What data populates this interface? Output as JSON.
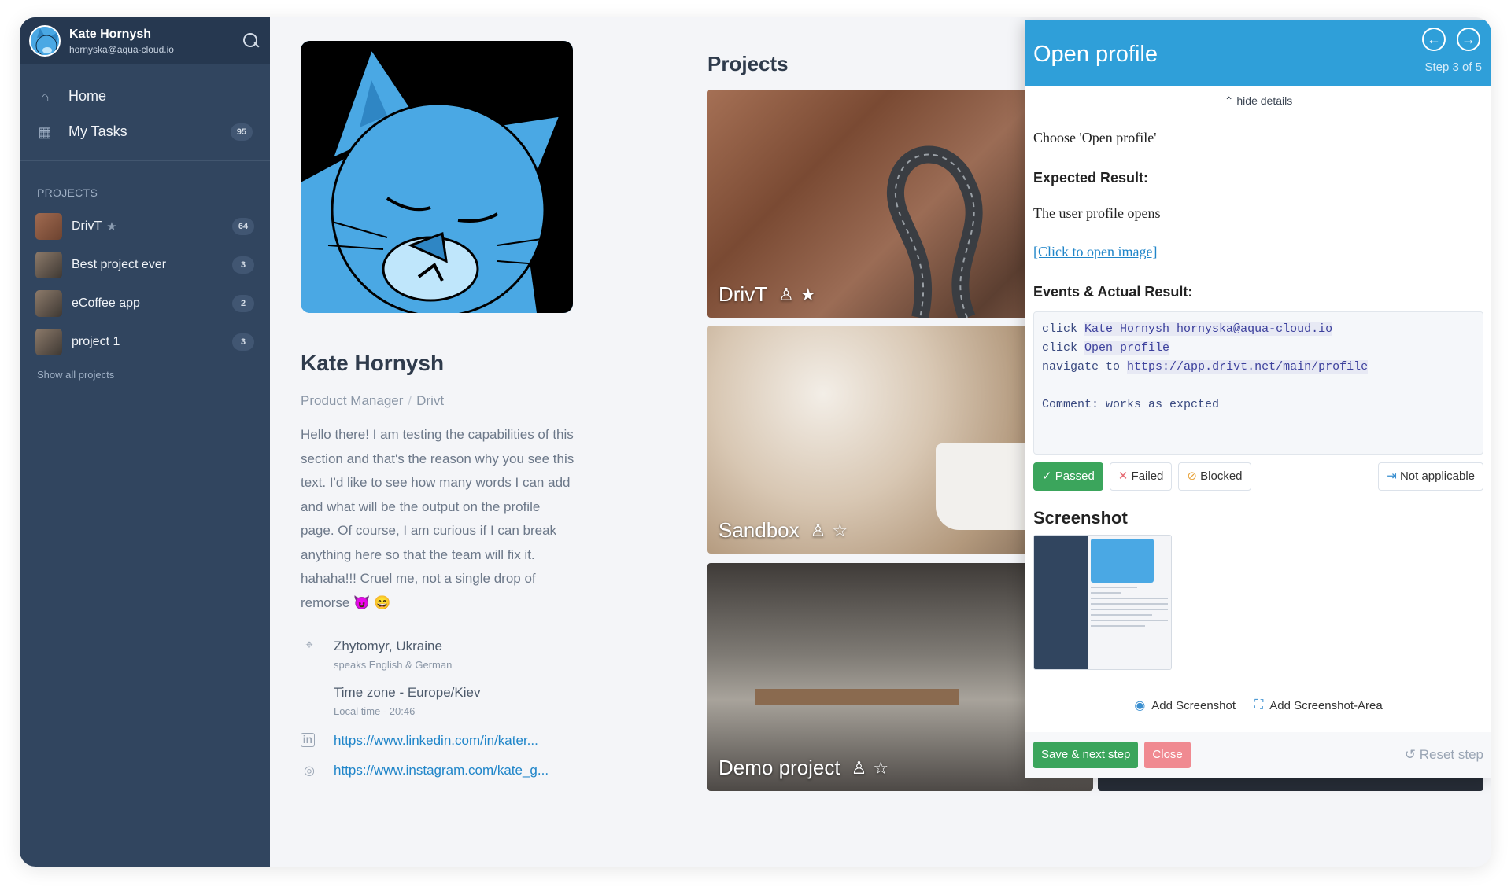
{
  "sidebar": {
    "user": {
      "name": "Kate Hornysh",
      "email": "hornyska@aqua-cloud.io"
    },
    "nav": [
      {
        "label": "Home",
        "icon": "home-icon",
        "badge": ""
      },
      {
        "label": "My Tasks",
        "icon": "calendar-icon",
        "badge": "95"
      }
    ],
    "projects_title": "PROJECTS",
    "projects": [
      {
        "label": "DrivT",
        "badge": "64",
        "starred": true
      },
      {
        "label": "Best project ever",
        "badge": "3"
      },
      {
        "label": "eCoffee app",
        "badge": "2"
      },
      {
        "label": "project 1",
        "badge": "3"
      }
    ],
    "show_all": "Show all projects"
  },
  "profile": {
    "name": "Kate Hornysh",
    "role": "Product Manager",
    "company": "Drivt",
    "bio": "Hello there! I am testing the capabilities of this section and that's the reason why you see this text. I'd like to see how many words I can add and what will be the output on the profile page. Of course, I am curious if I can break anything here so that the team will fix it. hahaha!!! Cruel me, not a single drop of remorse 😈 😄",
    "location": "Zhytomyr, Ukraine",
    "languages": "speaks English & German",
    "timezone": "Time zone - Europe/Kiev",
    "local_time": "Local time - 20:46",
    "linkedin": "https://www.linkedin.com/in/kater...",
    "instagram": "https://www.instagram.com/kate_g..."
  },
  "projects": {
    "title": "Projects",
    "cards": [
      {
        "label": "DrivT"
      },
      {
        "label": "Sandbox"
      },
      {
        "label": "Demo project"
      }
    ]
  },
  "panel": {
    "title": "Open profile",
    "step": "Step 3 of 5",
    "hide_details": "hide details",
    "instruction": "Choose 'Open profile'",
    "expected_heading": "Expected Result:",
    "expected_text": "The user profile opens",
    "image_link": "[Click to open image]",
    "events_heading": "Events & Actual Result:",
    "events": [
      {
        "verb": "click",
        "target": "Kate Hornysh hornyska@aqua-cloud.io"
      },
      {
        "verb": "click",
        "target": "Open profile"
      },
      {
        "verb": "navigate to",
        "target": "https://app.drivt.net/main/profile"
      }
    ],
    "comment": "Comment: works as expcted",
    "status": {
      "passed": "Passed",
      "failed": "Failed",
      "blocked": "Blocked",
      "na": "Not applicable"
    },
    "screenshot_heading": "Screenshot",
    "add_screenshot": "Add Screenshot",
    "add_screenshot_area": "Add Screenshot-Area",
    "save_next": "Save & next step",
    "close": "Close",
    "reset": "Reset step"
  }
}
